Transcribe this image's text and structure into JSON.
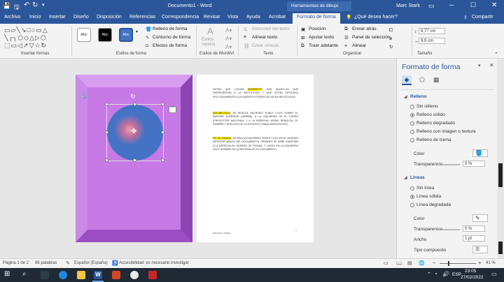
{
  "titlebar": {
    "doc_title": "Documento1 - Word",
    "context_group": "Herramientas de dibujo",
    "user": "Marc Stark"
  },
  "tabs": [
    "Archivo",
    "Inicio",
    "Insertar",
    "Diseño",
    "Disposición",
    "Referencias",
    "Correspondencia",
    "Revisar",
    "Vista",
    "Ayuda",
    "Acrobat",
    "Formato de forma"
  ],
  "tell_me": "¿Qué desea hacer?",
  "share": "Compartir",
  "ribbon": {
    "groups": {
      "insert_shapes": "Insertar formas",
      "shape_styles": "Estilos de forma",
      "wordart": "Estilos de WordArt",
      "text": "Texto",
      "arrange": "Organizar",
      "size": "Tamaño"
    },
    "style_label": "Abc",
    "fill": "Relleno de forma",
    "outline": "Contorno de forma",
    "effects": "Efectos de forma",
    "quick_styles": "Estilos rápidos",
    "text_dir": "Dirección del texto",
    "align_text": "Alinear texto",
    "create_link": "Crear vínculo",
    "position": "Posición",
    "wrap": "Ajustar texto",
    "bring_forward": "Traer adelante",
    "send_back": "Enviar atrás",
    "selection_pane": "Panel de selección",
    "align": "Alinear",
    "height": "9,77 cm",
    "width": "9,9 cm"
  },
  "doc": {
    "p1_hl": "MEMBRETE",
    "p1_pre": "NOTAS QUE LLEVAN",
    "p1": ": SON AQUELLAS QUE REPRESENTAN A LA INSTITUCIÓN Y QUE ESTÁN DIRIGIDAS EXCLUSIVAMENTE A UN AGENTE EXTERNO DE DICHA INSTITUCIÓN.",
    "p2_hl": "ENCABEZADO",
    "p2": ": SE REALIZA HACIENDO DOBLE CLICK SOBRE EL MARGEN SUPERIOR (ARRIBA). A LA IZQUIERDA VA EL CURSO (PRECEPTOR NACIONAL) Y A LA DERECHA, MISMO RENGLÓN, EL NOMBRE Y APELLIDO DE LA DOCENTE (VIANA SANTACROCE).",
    "p3_hl": "PIE DE PÁGINA",
    "p3": ": SE REALIZA HACIENDO DOBLE CLICK EN EL MARGEN INFERIOR (ABAJO DEL DOCUMENTO). PRIMERO SE DEBE INSERTAR A LA DERECHA EL NÚMERO DE PÁGINA, Y LUEGO EN LA IZQUIERDA VA EL NOMBRE DE QUIEN REALIZÓ EL DOCUMENTO.",
    "footer_left": "MARCELO STARK",
    "footer_right": "1"
  },
  "pane": {
    "title": "Formato de forma",
    "fill_section": "Relleno",
    "fill_options": [
      "Sin relleno",
      "Relleno sólido",
      "Relleno degradado",
      "Relleno con imagen o textura",
      "Relleno de trama"
    ],
    "fill_selected": 1,
    "color": "Color",
    "transparency": "Transparencia",
    "fill_transp": "0 %",
    "line_section": "Líneas",
    "line_options": [
      "Sin línea",
      "Línea sólida",
      "Línea degradada"
    ],
    "line_selected": 1,
    "line_transp": "0 %",
    "width_label": "Ancho",
    "width_val": "1 pt",
    "compound": "Tipo compuesto"
  },
  "status": {
    "page": "Página 1 de 2",
    "words": "96 palabras",
    "lang": "Español (España)",
    "access": "Accesibilidad: es necesario investigar",
    "zoom": "41 %"
  },
  "taskbar": {
    "lang": "ESP",
    "time": "23:05",
    "date": "27/02/2022"
  },
  "colors": {
    "brand": "#2b579a",
    "shape_purple": "#c77ae6",
    "circle": "#4472c4",
    "taskbar": "#1f2a35"
  }
}
